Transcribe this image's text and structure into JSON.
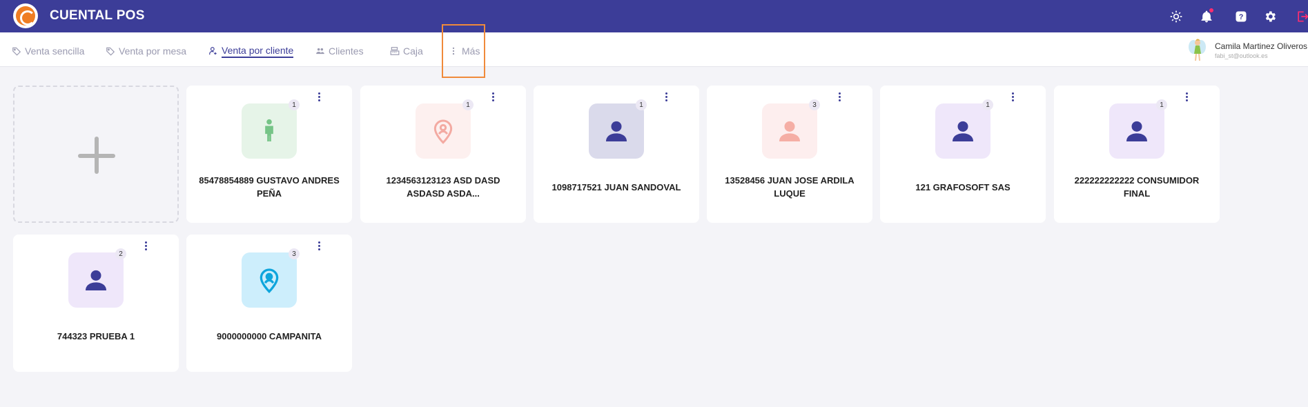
{
  "app": {
    "title": "CUENTAL POS"
  },
  "colors": {
    "header_bg": "#3c3d98",
    "accent": "#3c3d98",
    "highlight": "#f08a3a",
    "notification": "#ff2d6f"
  },
  "topbar_icons": [
    "theme-sun-icon",
    "bell-icon",
    "help-icon",
    "gear-icon",
    "logout-icon"
  ],
  "nav": {
    "items": [
      {
        "label": "Venta sencilla",
        "icon": "tag-icon"
      },
      {
        "label": "Venta por mesa",
        "icon": "tag-icon"
      },
      {
        "label": "Venta por cliente",
        "icon": "user-icon",
        "active": true
      },
      {
        "label": "Clientes",
        "icon": "users-icon"
      },
      {
        "label": "Caja",
        "icon": "cash-register-icon"
      },
      {
        "label": "Más",
        "icon": "dots-vertical-icon"
      }
    ]
  },
  "user": {
    "name": "Camila Martinez Oliveros",
    "email": "fabi_st@outlook.es"
  },
  "customers": [
    {
      "name": "85478854889 GUSTAVO ANDRES PEÑA",
      "count": "1",
      "icon": "child-icon",
      "tile_color": "#e6f4e8",
      "icon_color": "#76c487"
    },
    {
      "name": "1234563123123 ASD DASD ASDASD ASDA...",
      "count": "1",
      "icon": "user-pin-icon",
      "tile_color": "#fdf0ef",
      "icon_color": "#f3aaa2"
    },
    {
      "name": "1098717521 JUAN SANDOVAL",
      "count": "1",
      "icon": "user-icon",
      "tile_color": "#dadaeb",
      "icon_color": "#3c3d98"
    },
    {
      "name": "13528456 JUAN JOSE ARDILA LUQUE",
      "count": "3",
      "icon": "user-icon",
      "tile_color": "#fdeeee",
      "icon_color": "#f5aea5"
    },
    {
      "name": "121 GRAFOSOFT SAS",
      "count": "1",
      "icon": "user-icon",
      "tile_color": "#efe7fa",
      "icon_color": "#3c3d98"
    },
    {
      "name": "222222222222 CONSUMIDOR FINAL",
      "count": "1",
      "icon": "user-icon",
      "tile_color": "#efe7fa",
      "icon_color": "#3c3d98"
    },
    {
      "name": "744323 PRUEBA 1",
      "count": "2",
      "icon": "user-icon",
      "tile_color": "#efe7fa",
      "icon_color": "#3c3d98"
    },
    {
      "name": "9000000000 CAMPANITA",
      "count": "3",
      "icon": "user-pin-icon",
      "tile_color": "#cdeefc",
      "icon_color": "#0ea5dc"
    }
  ]
}
